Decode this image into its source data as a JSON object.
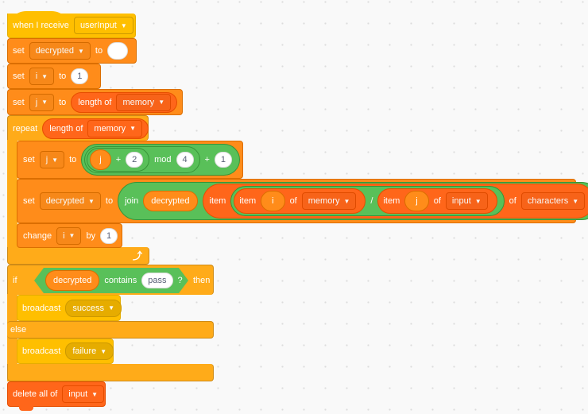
{
  "hat": {
    "label": "when I receive",
    "message": "userInput"
  },
  "set_decrypted": {
    "set": "set",
    "var": "decrypted",
    "to": "to",
    "value": ""
  },
  "set_i": {
    "set": "set",
    "var": "i",
    "to": "to",
    "value": "1"
  },
  "set_j": {
    "set": "set",
    "var": "j",
    "to": "to",
    "length_of": "length of",
    "list": "memory"
  },
  "repeat": {
    "label": "repeat",
    "length_of": "length of",
    "list": "memory"
  },
  "set_j_mod": {
    "set": "set",
    "var": "j",
    "to": "to",
    "reporter_j": "j",
    "plus1": "+",
    "two": "2",
    "mod": "mod",
    "four": "4",
    "plus2": "+",
    "one": "1"
  },
  "set_decrypted_join": {
    "set": "set",
    "var": "decrypted",
    "to": "to",
    "join": "join",
    "reporter_decrypted": "decrypted",
    "item_outer": "item",
    "item_i": "item",
    "reporter_i": "i",
    "of1": "of",
    "list_memory": "memory",
    "divide": "/",
    "item_j": "item",
    "reporter_j": "j",
    "of2": "of",
    "list_input": "input",
    "of3": "of",
    "list_characters": "characters"
  },
  "change_i": {
    "label": "change",
    "var": "i",
    "by": "by",
    "value": "1"
  },
  "if_block": {
    "if": "if",
    "reporter": "decrypted",
    "contains": "contains",
    "text": "pass",
    "q": "?",
    "then": "then",
    "else": "else"
  },
  "broadcast_success": {
    "label": "broadcast",
    "message": "success"
  },
  "broadcast_failure": {
    "label": "broadcast",
    "message": "failure"
  },
  "delete_all": {
    "label": "delete all of",
    "list": "input"
  },
  "icons": {
    "caret": "▼",
    "loop_arrow": "⤴"
  }
}
